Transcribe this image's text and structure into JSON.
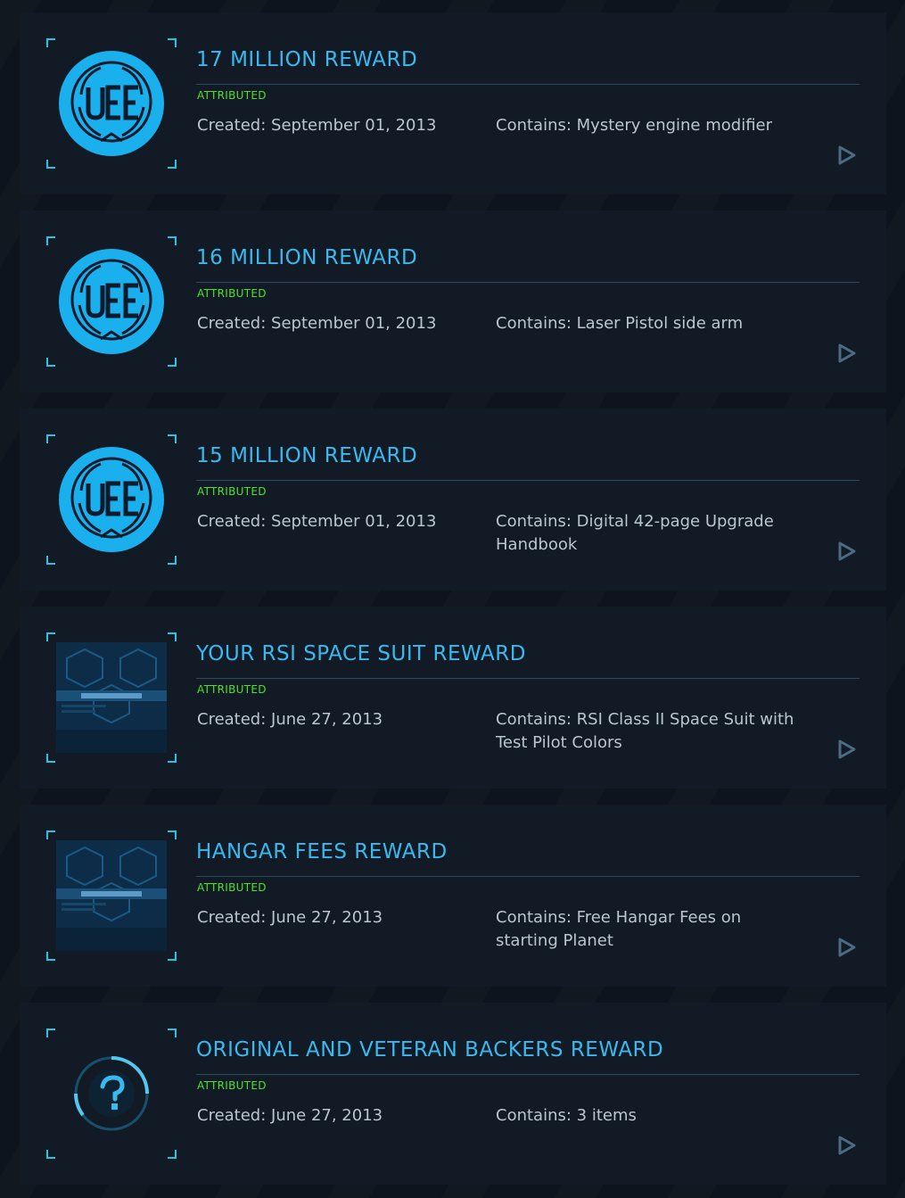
{
  "colors": {
    "title": "#3ab9ef",
    "status": "#4ee02c",
    "text": "#b9c6d0",
    "card_bg": "#111a25",
    "page_bg": "#0d141d",
    "accent": "#2fc2dc"
  },
  "rewards": [
    {
      "title": "17 MILLION REWARD",
      "status": "ATTRIBUTED",
      "created": "Created: September 01, 2013",
      "contains": "Contains: Mystery engine modifier",
      "image": "uee-emblem-icon"
    },
    {
      "title": "16 MILLION REWARD",
      "status": "ATTRIBUTED",
      "created": "Created: September 01, 2013",
      "contains": "Contains: Laser Pistol side arm",
      "image": "uee-emblem-icon"
    },
    {
      "title": "15 MILLION REWARD",
      "status": "ATTRIBUTED",
      "created": "Created: September 01, 2013",
      "contains": "Contains: Digital 42-page Upgrade Handbook",
      "image": "uee-emblem-icon"
    },
    {
      "title": "YOUR RSI SPACE SUIT REWARD",
      "status": "ATTRIBUTED",
      "created": "Created: June 27, 2013",
      "contains": "Contains: RSI Class II Space Suit with Test Pilot Colors",
      "image": "hangar-screen-thumbnail"
    },
    {
      "title": "HANGAR FEES REWARD",
      "status": "ATTRIBUTED",
      "created": "Created: June 27, 2013",
      "contains": "Contains: Free Hangar Fees on starting Planet",
      "image": "hangar-screen-thumbnail"
    },
    {
      "title": "ORIGINAL AND VETERAN BACKERS REWARD",
      "status": "ATTRIBUTED",
      "created": "Created: June 27, 2013",
      "contains": "Contains: 3 items",
      "image": "mystery-question-icon"
    }
  ]
}
